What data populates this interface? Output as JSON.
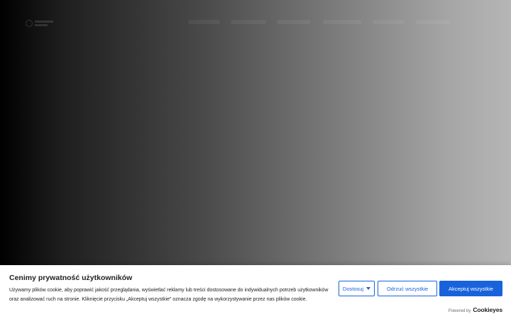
{
  "cookie_banner": {
    "title": "Cenimy prywatność użytkowników",
    "text": "Używamy plików cookie, aby poprawić jakość przeglądania, wyświetlać reklamy lub treści dostosowane do indywidualnych potrzeb użytkowników oraz analizować ruch na stronie. Kliknięcie przycisku „Akceptuj wszystkie” oznacza zgodę na wykorzystywanie przez nas plików cookie.",
    "buttons": {
      "customize": "Dostosuj",
      "reject": "Odrzuć wszystkie",
      "accept": "Akceptuj wszystkie"
    },
    "powered_by": "Powered by",
    "brand": "Cookieyes",
    "accent_color": "#1863dc"
  },
  "icons": {
    "customize_dropdown": "caret-down-icon",
    "site_logo": "logo-icon"
  }
}
